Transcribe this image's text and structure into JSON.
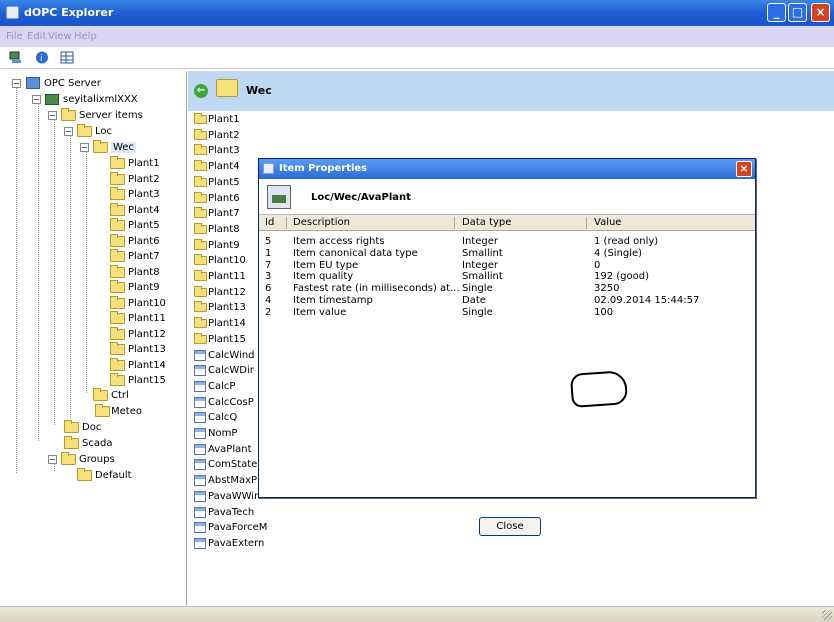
{
  "window": {
    "title": "dOPC Explorer"
  },
  "menu": [
    "File",
    "Edit",
    "View",
    "Help"
  ],
  "toolbar_icons": [
    "connect-icon",
    "info-icon",
    "grid-icon"
  ],
  "tree": {
    "root": "OPC Server",
    "server": "seyitalixmlXXX",
    "server_items": "Server items",
    "loc": "Loc",
    "wec": "Wec",
    "plants": [
      "Plant1",
      "Plant2",
      "Plant3",
      "Plant4",
      "Plant5",
      "Plant6",
      "Plant7",
      "Plant8",
      "Plant9",
      "Plant10",
      "Plant11",
      "Plant12",
      "Plant13",
      "Plant14",
      "Plant15"
    ],
    "ctrl": "Ctrl",
    "meteo": "Meteo",
    "doc": "Doc",
    "scada": "Scada",
    "groups": "Groups",
    "default": "Default"
  },
  "right_pane": {
    "path": "Wec",
    "folders": [
      "Plant1",
      "Plant2",
      "Plant3",
      "Plant4",
      "Plant5",
      "Plant6",
      "Plant7",
      "Plant8",
      "Plant9",
      "Plant10",
      "Plant11",
      "Plant12",
      "Plant13",
      "Plant14",
      "Plant15"
    ],
    "items": [
      "CalcWind",
      "CalcWDir",
      "CalcP",
      "CalcCosP",
      "CalcQ",
      "NomP",
      "AvaPlant",
      "ComState",
      "AbstMaxP",
      "PavaWWin",
      "PavaTech",
      "PavaForceM",
      "PavaExtern"
    ]
  },
  "dialog": {
    "title": "Item Properties",
    "item_path": "Loc/Wec/AvaPlant",
    "columns": {
      "id": "Id",
      "description": "Description",
      "data_type": "Data type",
      "value": "Value"
    },
    "rows": [
      {
        "id": "5",
        "description": "Item access rights",
        "data_type": "Integer",
        "value": "1 (read only)"
      },
      {
        "id": "1",
        "description": "Item canonical data type",
        "data_type": "Smallint",
        "value": "4 (Single)"
      },
      {
        "id": "7",
        "description": "Item EU type",
        "data_type": "Integer",
        "value": "0"
      },
      {
        "id": "3",
        "description": "Item quality",
        "data_type": "Smallint",
        "value": "192 (good)"
      },
      {
        "id": "6",
        "description": "Fastest rate (in milliseconds) at...",
        "data_type": "Single",
        "value": "3250"
      },
      {
        "id": "4",
        "description": "Item timestamp",
        "data_type": "Date",
        "value": "02.09.2014 15:44:57"
      },
      {
        "id": "2",
        "description": "Item value",
        "data_type": "Single",
        "value": "100"
      }
    ],
    "close_label": "Close"
  }
}
